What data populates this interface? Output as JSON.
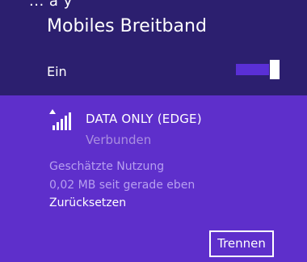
{
  "top_partial_text": "... a y",
  "section_title": "Mobiles Breitband",
  "toggle": {
    "label": "Ein",
    "state": "on"
  },
  "network": {
    "name": "DATA ONLY (EDGE)",
    "status": "Verbunden",
    "usage_label": "Geschätzte Nutzung",
    "usage_value": "0,02 MB seit gerade eben",
    "reset_label": "Zurücksetzen",
    "disconnect_label": "Trennen",
    "signal_icon": "mobile-signal-icon"
  },
  "colors": {
    "header_bg": "#2c1f6f",
    "network_bg": "#5e2fcb",
    "toggle_accent": "#5a2fd6",
    "muted_text": "#b79ff0"
  }
}
